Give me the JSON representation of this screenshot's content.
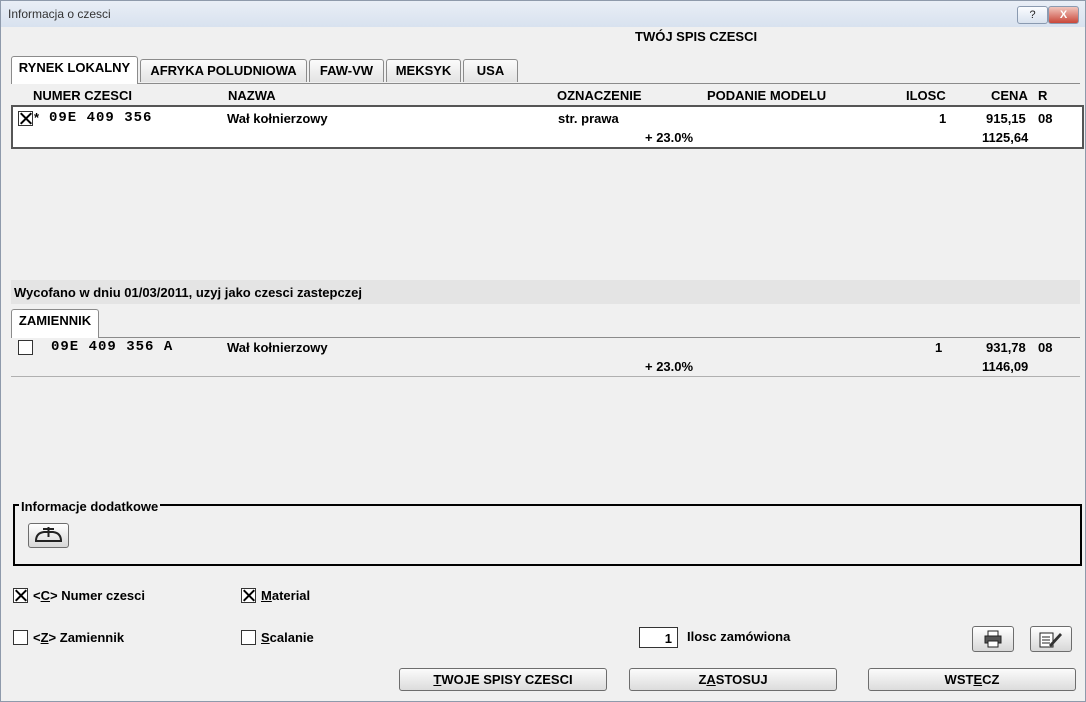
{
  "window": {
    "title": "Informacja o czesci",
    "help_label": "?",
    "close_label": "X"
  },
  "header": {
    "title": "TWÓJ SPIS CZESCI"
  },
  "tabs": [
    {
      "label": "RYNEK LOKALNY",
      "active": true
    },
    {
      "label": "AFRYKA POLUDNIOWA",
      "active": false
    },
    {
      "label": "FAW-VW",
      "active": false
    },
    {
      "label": "MEKSYK",
      "active": false
    },
    {
      "label": "USA",
      "active": false
    }
  ],
  "columns": {
    "numer": "NUMER CZESCI",
    "nazwa": "NAZWA",
    "oznaczenie": "OZNACZENIE",
    "podanie": "PODANIE MODELU",
    "ilosc": "ILOSC",
    "cena": "CENA",
    "r": "R"
  },
  "main_part": {
    "checked": true,
    "star": "*",
    "number": "09E 409 356",
    "name": "Wał kołnierzowy",
    "designation": "str. prawa",
    "qty": "1",
    "price": "915,15",
    "r": "08",
    "vat": "+ 23.0%",
    "gross": "1125,64"
  },
  "withdrawn_note": "Wycofano w dniu 01/03/2011, uzyj jako czesci zastepczej",
  "replacement_tab": "ZAMIENNIK",
  "replacement_part": {
    "checked": false,
    "number": "09E 409 356 A",
    "name": "Wał kołnierzowy",
    "qty": "1",
    "price": "931,78",
    "r": "08",
    "vat": "+ 23.0%",
    "gross": "1146,09"
  },
  "info_group": {
    "label": "Informacje dodatkowe",
    "icon": "engine-icon"
  },
  "options": {
    "numer": {
      "label_pre": "<",
      "key": "C",
      "label_post": "> Numer czesci",
      "checked": true
    },
    "material": {
      "key": "M",
      "label_post": "aterial",
      "checked": true
    },
    "zamiennik": {
      "label_pre": "<",
      "key": "Z",
      "label_post": "> Zamiennik",
      "checked": false
    },
    "scalanie": {
      "key": "S",
      "label_post": "calanie",
      "checked": false
    }
  },
  "order": {
    "qty": "1",
    "label": "Ilosc zamówiona"
  },
  "buttons": {
    "spisy": {
      "key": "T",
      "rest": "WOJE SPISY CZESCI"
    },
    "zastosuj": {
      "pre": "Z",
      "key": "A",
      "rest": "STOSUJ"
    },
    "wstecz": {
      "pre": "WST",
      "key": "E",
      "rest": "CZ"
    }
  },
  "icons": {
    "print": "printer-icon",
    "edit": "edit-list-icon"
  }
}
